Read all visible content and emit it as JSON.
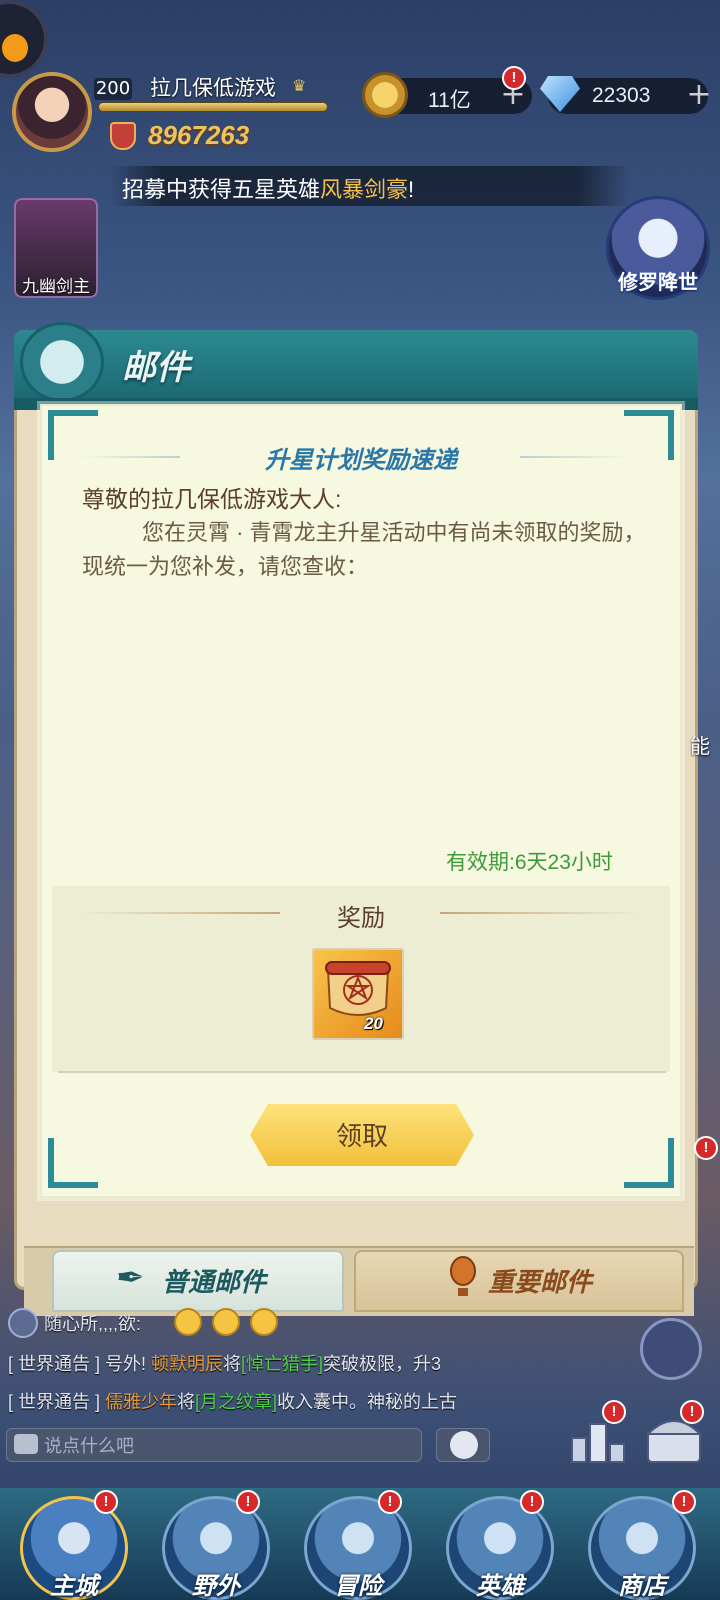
{
  "player": {
    "level": "200",
    "name": "拉几保低游戏",
    "power": "8967263"
  },
  "resources": {
    "gold": "11亿",
    "gems": "22303",
    "gold_badge": "!"
  },
  "banner": {
    "prefix": "招募中获得五星英雄",
    "hero": "风暴剑豪",
    "suffix": "!"
  },
  "side": {
    "hero_card": "九幽剑主",
    "boss_event": "修罗降世",
    "edge_text": "能"
  },
  "mail": {
    "title": "邮件",
    "letter": {
      "title": "升星计划奖励速递",
      "greeting": "尊敬的拉几保低游戏大人:",
      "body": "您在灵霄 · 青霄龙主升星活动中有尚未领取的奖励，现统一为您补发，请您查收：",
      "expiry": "有效期:6天23小时"
    },
    "rewards": {
      "title": "奖励",
      "items": [
        {
          "icon": "scroll-icon",
          "count": "20"
        }
      ]
    },
    "claim_label": "领取",
    "tabs": {
      "normal": "普通邮件",
      "important": "重要邮件"
    }
  },
  "chat": {
    "line1_user": "随心所,,,,欲:",
    "line2": {
      "tag": "[ 世界通告 ]",
      "a": " 号外! ",
      "name": "顿默明辰",
      "b": "将",
      "item": "[悼亡猎手]",
      "c": "突破极限，升3"
    },
    "line3": {
      "tag": "[ 世界通告 ]",
      "a": " ",
      "name": "儒雅少年",
      "b": "将",
      "item": "[月之纹章]",
      "c": "收入囊中。神秘的上古"
    },
    "placeholder": "说点什么吧"
  },
  "nav": [
    {
      "label": "主城",
      "badge": "!"
    },
    {
      "label": "野外",
      "badge": "!"
    },
    {
      "label": "冒险",
      "badge": "!"
    },
    {
      "label": "英雄",
      "badge": "!"
    },
    {
      "label": "商店",
      "badge": "!"
    }
  ],
  "badge_mark": "!",
  "colors": {
    "accent_gold": "#f5c14b",
    "teal": "#2c8a91",
    "expiry_green": "#3f9a3a",
    "badge_red": "#d7282a"
  }
}
